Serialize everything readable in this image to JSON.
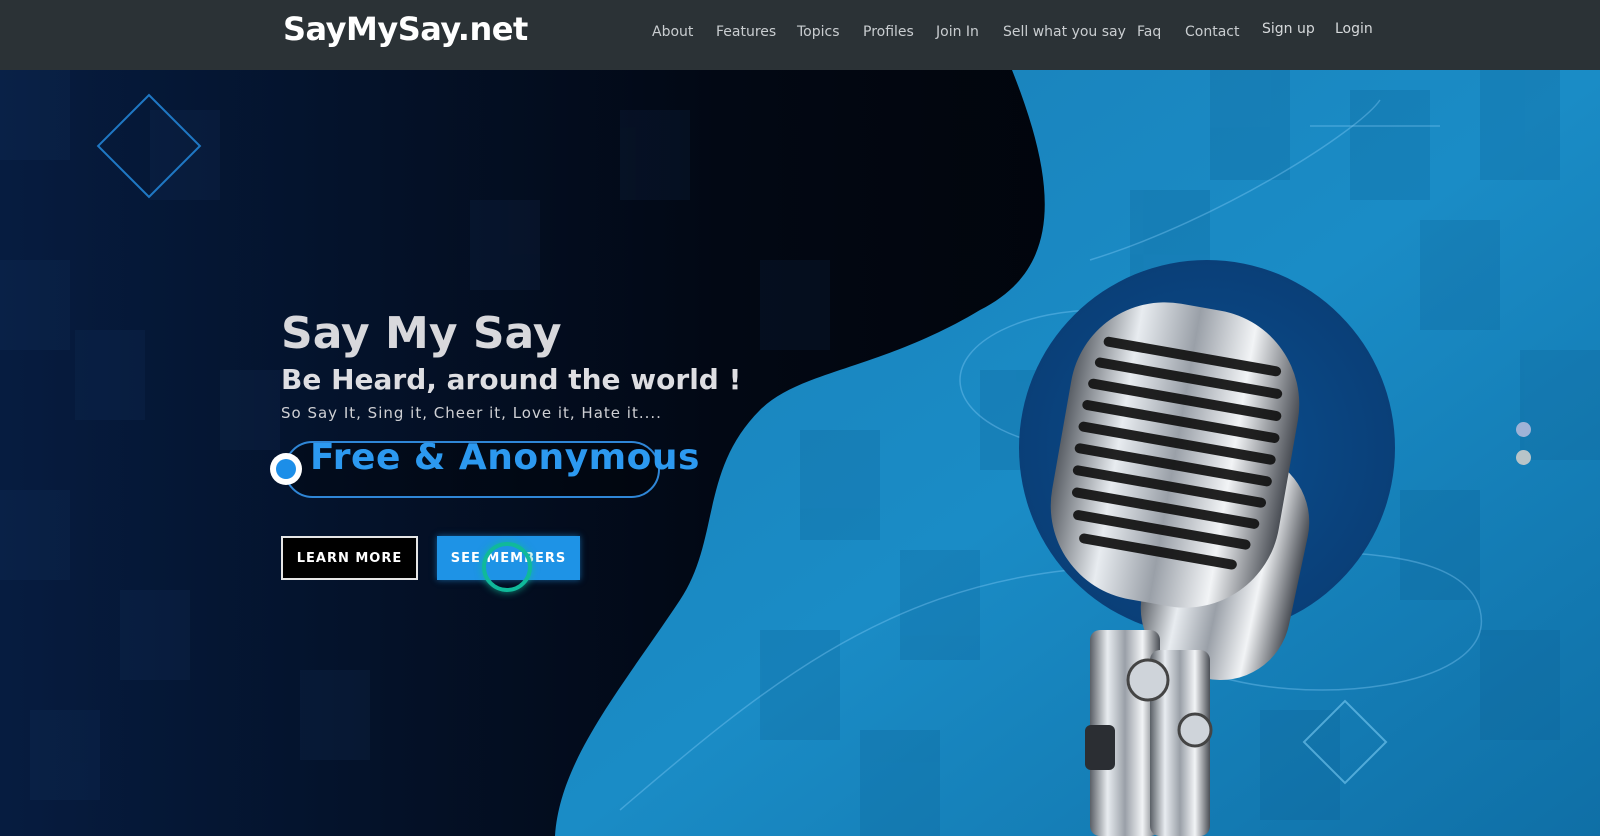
{
  "header": {
    "brand": "SayMySay.net",
    "nav": [
      {
        "label": "About"
      },
      {
        "label": "Features"
      },
      {
        "label": "Topics"
      },
      {
        "label": "Profiles"
      },
      {
        "label": "Join In"
      },
      {
        "label": "Sell what you say"
      },
      {
        "label": "Faq"
      },
      {
        "label": "Contact"
      }
    ],
    "signup_label": "Sign up",
    "login_label": "Login"
  },
  "hero": {
    "title": "Say My Say",
    "subtitle": "Be Heard, around the world !",
    "tagline": "So Say It, Sing it, Cheer it, Love it, Hate it....",
    "badge_text": "Free & Anonymous",
    "learn_more_label": "LEARN MORE",
    "see_members_label": "SEE MEMBERS",
    "slider_dots": 2,
    "active_slide": 1
  },
  "colors": {
    "nav_bg": "#2b3236",
    "accent_blue": "#1e93e6",
    "badge_text": "#2c99f0",
    "cursor_ring": "#10b99a"
  },
  "icons": {
    "hero_illustration": "microphone-icon",
    "decor": "diamond-outline-icon"
  }
}
